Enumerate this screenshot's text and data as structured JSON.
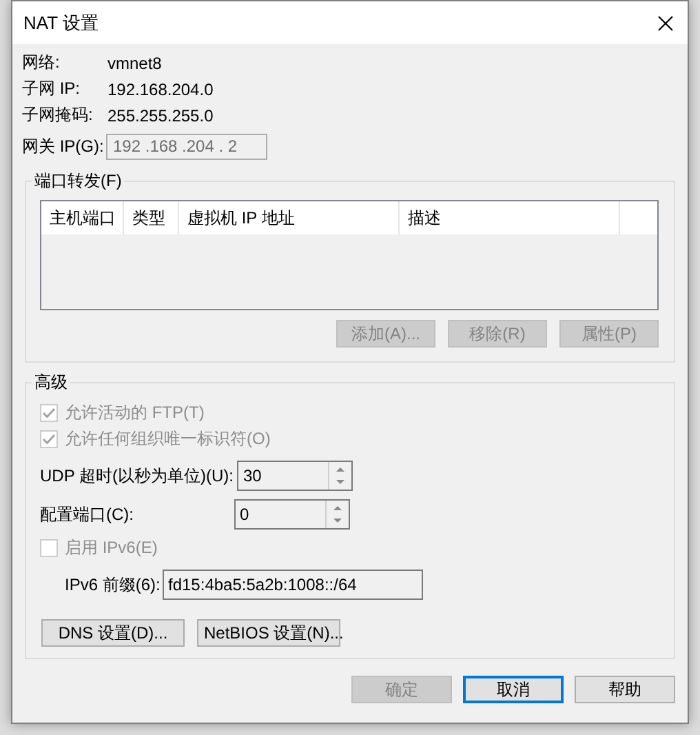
{
  "window": {
    "title": "NAT 设置"
  },
  "info": [
    {
      "label": "网络:",
      "value": "vmnet8"
    },
    {
      "label": "子网 IP:",
      "value": "192.168.204.0"
    },
    {
      "label": "子网掩码:",
      "value": "255.255.255.0"
    }
  ],
  "gateway": {
    "label": "网关 IP(G):",
    "value": "192 .168 .204 . 2",
    "disabled": true
  },
  "port_forwarding": {
    "title": "端口转发(F)",
    "columns": [
      "主机端口",
      "类型",
      "虚拟机 IP 地址",
      "描述"
    ],
    "buttons": [
      {
        "label": "添加(A)...",
        "disabled": true
      },
      {
        "label": "移除(R)",
        "disabled": true
      },
      {
        "label": "属性(P)",
        "disabled": true
      }
    ]
  },
  "advanced": {
    "title": "高级",
    "options": [
      {
        "label": "允许活动的 FTP(T)",
        "checked": true,
        "disabled": true
      },
      {
        "label": "允许任何组织唯一标识符(O)",
        "checked": true,
        "disabled": true
      }
    ],
    "spinners": [
      {
        "label": "UDP 超时(以秒为单位)(U):",
        "value": "30"
      },
      {
        "label": "配置端口(C):",
        "value": "0"
      }
    ],
    "ipv6": {
      "label": "启用 IPv6(E)",
      "checked": false,
      "disabled": true
    },
    "ipv6_prefix": {
      "label": "IPv6 前缀(6):",
      "value": "fd15:4ba5:5a2b:1008::/64"
    },
    "buttons": [
      {
        "label": "DNS 设置(D)..."
      },
      {
        "label": "NetBIOS 设置(N)..."
      }
    ]
  },
  "buttons": [
    {
      "label": "确定",
      "disabled": true,
      "focused": false
    },
    {
      "label": "取消",
      "disabled": false,
      "focused": true
    },
    {
      "label": "帮助",
      "disabled": false,
      "focused": false
    }
  ]
}
